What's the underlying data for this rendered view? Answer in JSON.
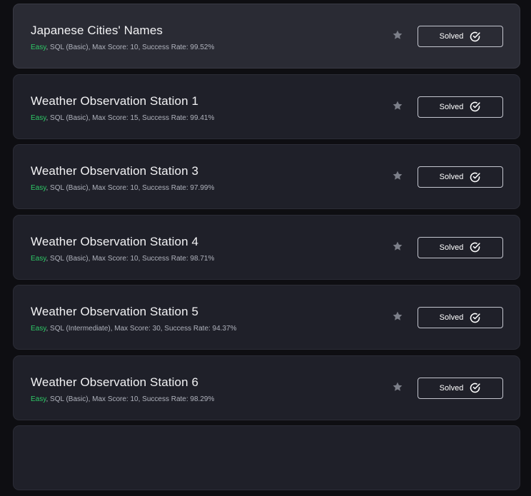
{
  "challenges": [
    {
      "title": "Japanese Cities' Names",
      "difficulty": "Easy",
      "details": ", SQL (Basic), Max Score: 10, Success Rate: 99.52%",
      "status": "Solved"
    },
    {
      "title": "Weather Observation Station 1",
      "difficulty": "Easy",
      "details": ", SQL (Basic), Max Score: 15, Success Rate: 99.41%",
      "status": "Solved"
    },
    {
      "title": "Weather Observation Station 3",
      "difficulty": "Easy",
      "details": ", SQL (Basic), Max Score: 10, Success Rate: 97.99%",
      "status": "Solved"
    },
    {
      "title": "Weather Observation Station 4",
      "difficulty": "Easy",
      "details": ", SQL (Basic), Max Score: 10, Success Rate: 98.71%",
      "status": "Solved"
    },
    {
      "title": "Weather Observation Station 5",
      "difficulty": "Easy",
      "details": ", SQL (Intermediate), Max Score: 30, Success Rate: 94.37%",
      "status": "Solved"
    },
    {
      "title": "Weather Observation Station 6",
      "difficulty": "Easy",
      "details": ", SQL (Basic), Max Score: 10, Success Rate: 98.29%",
      "status": "Solved"
    }
  ],
  "colors": {
    "easy": "#2ec866",
    "card": "#1f2029",
    "card_hover": "#2a2b34",
    "star": "#7c7f89"
  },
  "icons": {
    "bookmark": "star-icon",
    "solved": "check-circle-icon"
  }
}
